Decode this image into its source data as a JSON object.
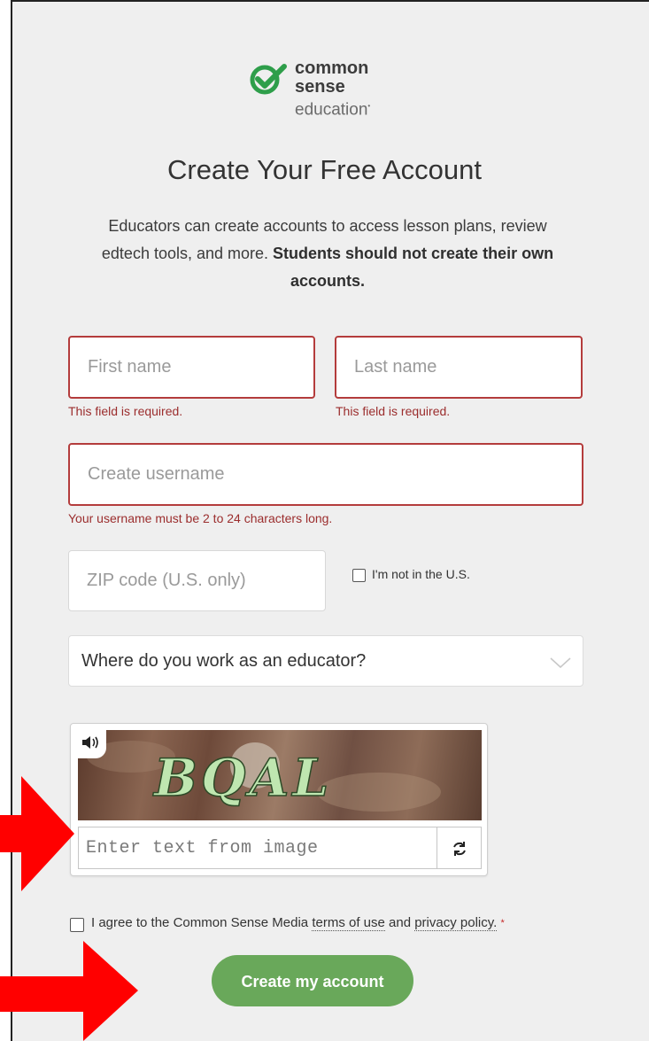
{
  "brand": {
    "line1": "common",
    "line2": "sense",
    "line3": "education",
    "color": "#2e9e4a"
  },
  "heading": "Create Your Free Account",
  "intro": {
    "text": "Educators can create accounts to access lesson plans, review edtech tools, and more.",
    "bold": "Students should not create their own accounts."
  },
  "form": {
    "first_name": {
      "placeholder": "First name",
      "error": "This field is required."
    },
    "last_name": {
      "placeholder": "Last name",
      "error": "This field is required."
    },
    "username": {
      "placeholder": "Create username",
      "error": "Your username must be 2 to 24 characters long."
    },
    "zip": {
      "placeholder": "ZIP code (U.S. only)"
    },
    "not_us": {
      "label": "I'm not in the U.S.",
      "checked": false
    },
    "workplace": {
      "value": "Where do you work as an educator?"
    },
    "captcha": {
      "image_text": "BQAL",
      "placeholder": "Enter text from image"
    },
    "agree": {
      "prefix": "I agree to the Common Sense Media",
      "terms": "terms of use",
      "and": "and",
      "privacy": "privacy policy.",
      "required_mark": "*",
      "checked": false
    },
    "submit_label": "Create my account"
  },
  "colors": {
    "error": "#b43c3c",
    "button": "#69a85a",
    "arrow": "#ff0000"
  }
}
